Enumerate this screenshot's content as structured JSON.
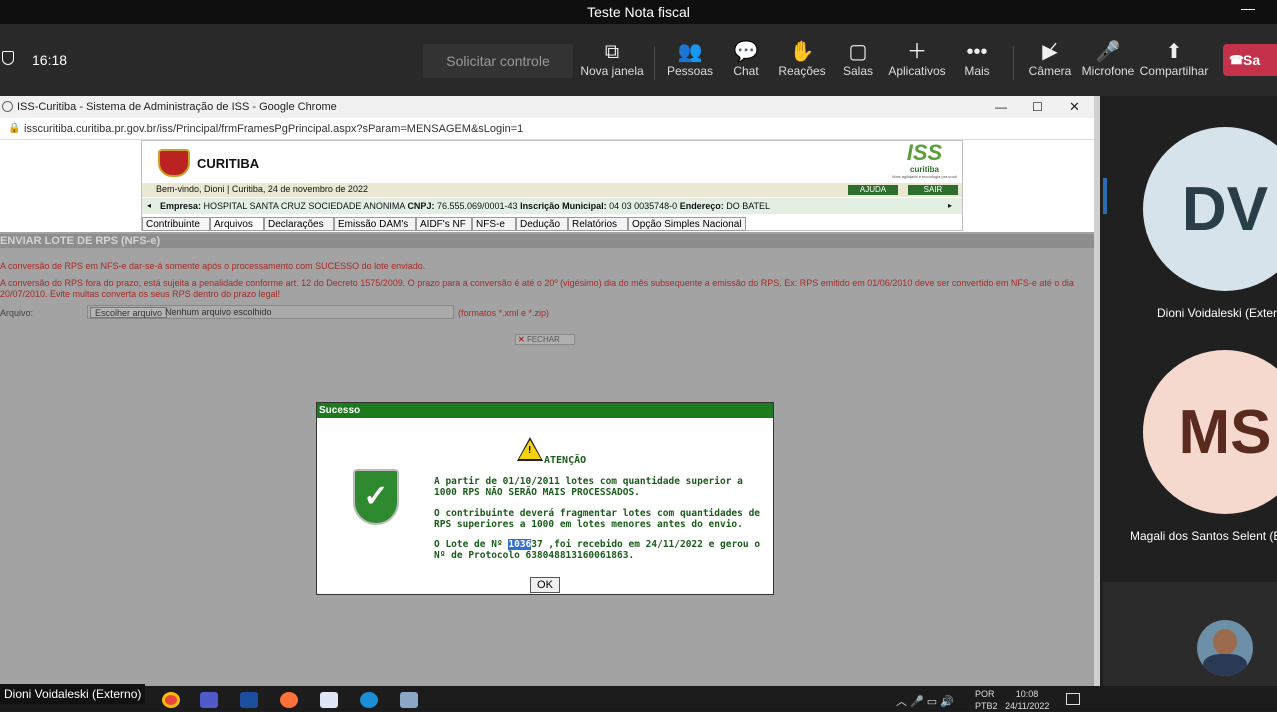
{
  "teams": {
    "window_title": "Teste Nota fiscal",
    "time": "16:18",
    "request_control": "Solicitar controle",
    "tools": [
      {
        "label": "Nova janela",
        "icon": "new-window-icon"
      },
      {
        "label": "Pessoas",
        "icon": "people-icon"
      },
      {
        "label": "Chat",
        "icon": "chat-icon"
      },
      {
        "label": "Reações",
        "icon": "reactions-icon"
      },
      {
        "label": "Salas",
        "icon": "rooms-icon"
      },
      {
        "label": "Aplicativos",
        "icon": "plus-icon"
      },
      {
        "label": "Mais",
        "icon": "more-icon"
      },
      {
        "label": "Câmera",
        "icon": "camera-off-icon"
      },
      {
        "label": "Microfone",
        "icon": "microphone-icon"
      },
      {
        "label": "Compartilhar",
        "icon": "share-icon"
      }
    ],
    "leave_label": "Sa"
  },
  "chrome": {
    "title": "ISS-Curitiba - Sistema de Administração de ISS - Google Chrome",
    "url": "isscuritiba.curitiba.pr.gov.br/iss/Principal/frmFramesPgPrincipal.aspx?sParam=MENSAGEM&sLogin=1"
  },
  "iss": {
    "city": "CURITIBA",
    "logo": "ISS",
    "logo_sub": "curitiba",
    "logo_tagline": "Mais agilidade e tecnologia pra você",
    "welcome": "Bem-vindo, Dioni | Curitiba, 24 de novembro de 2022",
    "ajuda": "AJUDA",
    "sair": "SAIR",
    "empresa_label": "Empresa:",
    "empresa": "HOSPITAL SANTA CRUZ SOCIEDADE ANONIMA",
    "cnpj_label": "CNPJ:",
    "cnpj": "76.555.069/0001-43",
    "im_label": "Inscrição Municipal:",
    "im": "04 03 0035748-0",
    "end_label": "Endereço:",
    "end": "DO BATEL",
    "tabs": [
      "Contribuinte",
      "Arquivos",
      "Declarações",
      "Emissão DAM's",
      "AIDF's NF",
      "NFS-e",
      "Dedução",
      "Relatórios",
      "Opção Simples Nacional"
    ]
  },
  "content": {
    "heading": "ENVIAR LOTE DE RPS (NFS-e)",
    "note1": "A conversão de RPS em NFS-e dar-se-á somente após o processamento com SUCESSO do lote enviado.",
    "note2": "A conversão do RPS fora do prazo, está sujeita a penalidade conforme art. 12 do Decreto 1575/2009. O prazo para a conversão é até o 20º (vigésimo) dia do mês subsequente a emissão do RPS. Ex: RPS emitido em 01/06/2010 deve ser convertido em NFS-e até o dia 20/07/2010. Evite multas converta os seus RPS dentro do prazo legal!",
    "file_label": "Arquivo:",
    "file_button": "Escolher arquivo",
    "file_none": "Nenhum arquivo escolhido",
    "file_formats": "(formatos *.xml e *.zip)",
    "close_button": "FECHAR"
  },
  "dialog": {
    "title": "Sucesso",
    "attention": "ATENÇÃO",
    "p1": "A partir de 01/10/2011 lotes com quantidade superior a 1000 RPS NÃO SERÃO MAIS PROCESSADOS.",
    "p2": "O contribuinte deverá fragmentar lotes com quantidades de RPS superiores a 1000 em lotes menores antes do envio.",
    "p3_pre": "O Lote de Nº",
    "p3_sel": "1036",
    "p3_post": "37 ,foi recebido em 24/11/2022 e gerou o Nº de Protocolo 638048813160061863.",
    "ok": "OK"
  },
  "participants": [
    {
      "initials": "DV",
      "name": "Dioni Voidaleski (Extern",
      "bg": "#d6e3ea",
      "fg": "#2a3e4a"
    },
    {
      "initials": "MS",
      "name": "Magali dos Santos Selent (E",
      "bg": "#f5d9cf",
      "fg": "#5a2a1f"
    }
  ],
  "presenter": "Dioni Voidaleski (Externo)",
  "tray": {
    "lang1": "POR",
    "lang2": "PTB2",
    "time": "10:08",
    "date": "24/11/2022"
  }
}
